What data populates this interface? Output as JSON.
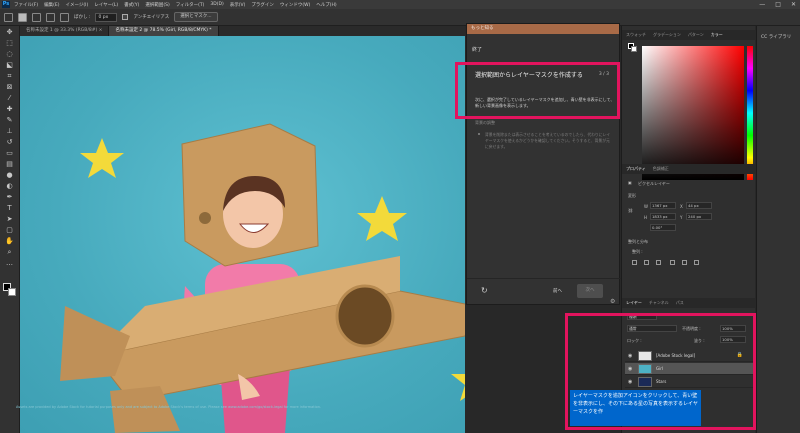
{
  "menu": {
    "app_icon": "Ps",
    "items": [
      "ファイル(F)",
      "編集(E)",
      "イメージ(I)",
      "レイヤー(L)",
      "書式(Y)",
      "選択範囲(S)",
      "フィルター(T)",
      "3D(D)",
      "表示(V)",
      "プラグイン",
      "ウィンドウ(W)",
      "ヘルプ(H)"
    ],
    "window_controls": [
      "—",
      "□",
      "✕"
    ]
  },
  "options_bar": {
    "feather_label": "ぼかし :",
    "feather_value": "0 px",
    "antialias_label": "アンチエイリアス",
    "select_mask_button": "選択とマスク..."
  },
  "tabs": [
    {
      "label": "名称未設定 1 @ 33.3% (RGB/8#) ×",
      "active": false
    },
    {
      "label": "名称未設定 2 @ 78.5% (Girl, RGB/8/CMYK) *",
      "active": true
    }
  ],
  "canvas": {
    "credit": "Assets are provided by Adobe Stock for tutorial purposes only and are subject to Adobe Stock's terms of use. Please see www.adobe.com/go/stock-legal for more information."
  },
  "learn_panel": {
    "header": "もっと知る",
    "done_label": "終了",
    "step_title": "選択範囲からレイヤーマスクを作成する",
    "step_count": "3 / 3",
    "step_desc": "次に、選択が完了しているレイヤーマスクを追加し、青い壁を非表示にして、新しい背景画像を表示します。",
    "subhead": "背景の調整",
    "sub_desc": "背景を削除または表示させることを考えているのでしたら、代わりにレイヤーマスクを使えるかどうかを確認してください。そうすると、背景が元に戻せます。",
    "prev_label": "前へ",
    "next_label": "次へ"
  },
  "color_panel": {
    "tabs": [
      "スウォッチ",
      "グラデーション",
      "パターン",
      "カラー"
    ],
    "active_tab": "カラー",
    "foreground": "#000000",
    "background": "#ffffff"
  },
  "properties_panel": {
    "tabs": [
      "プロパティ",
      "色調補正"
    ],
    "type_label": "ピクセルレイヤー",
    "transform_heading": "変形",
    "w_label": "W",
    "w_value": "1367 px",
    "h_label": "H",
    "h_value": "1833 px",
    "x_label": "X",
    "x_value": "44 px",
    "y_label": "Y",
    "y_value": "240 px",
    "angle_value": "0.00°",
    "align_heading": "整列と分布",
    "align_label": "整列 :"
  },
  "layers_panel": {
    "tabs": [
      "レイヤー",
      "チャンネル",
      "パス"
    ],
    "filter_label": "種類",
    "blend_mode": "通常",
    "opacity_label": "不透明度 :",
    "opacity_value": "100%",
    "lock_label": "ロック :",
    "fill_label": "塗り :",
    "fill_value": "100%",
    "layers": [
      {
        "name": "[Adobe Stock legal]",
        "selected": false,
        "locked": true
      },
      {
        "name": "Girl",
        "selected": true,
        "locked": false
      },
      {
        "name": "Stars",
        "selected": false,
        "locked": false
      }
    ]
  },
  "tooltip": "レイヤーマスクを追加アイコンをクリックして、青い壁を非表示にし、その下にある星の写真を表示するレイヤーマスクを作",
  "far_dock": {
    "item": "CC ライブラリ"
  },
  "highlight_color": "#e2145e"
}
